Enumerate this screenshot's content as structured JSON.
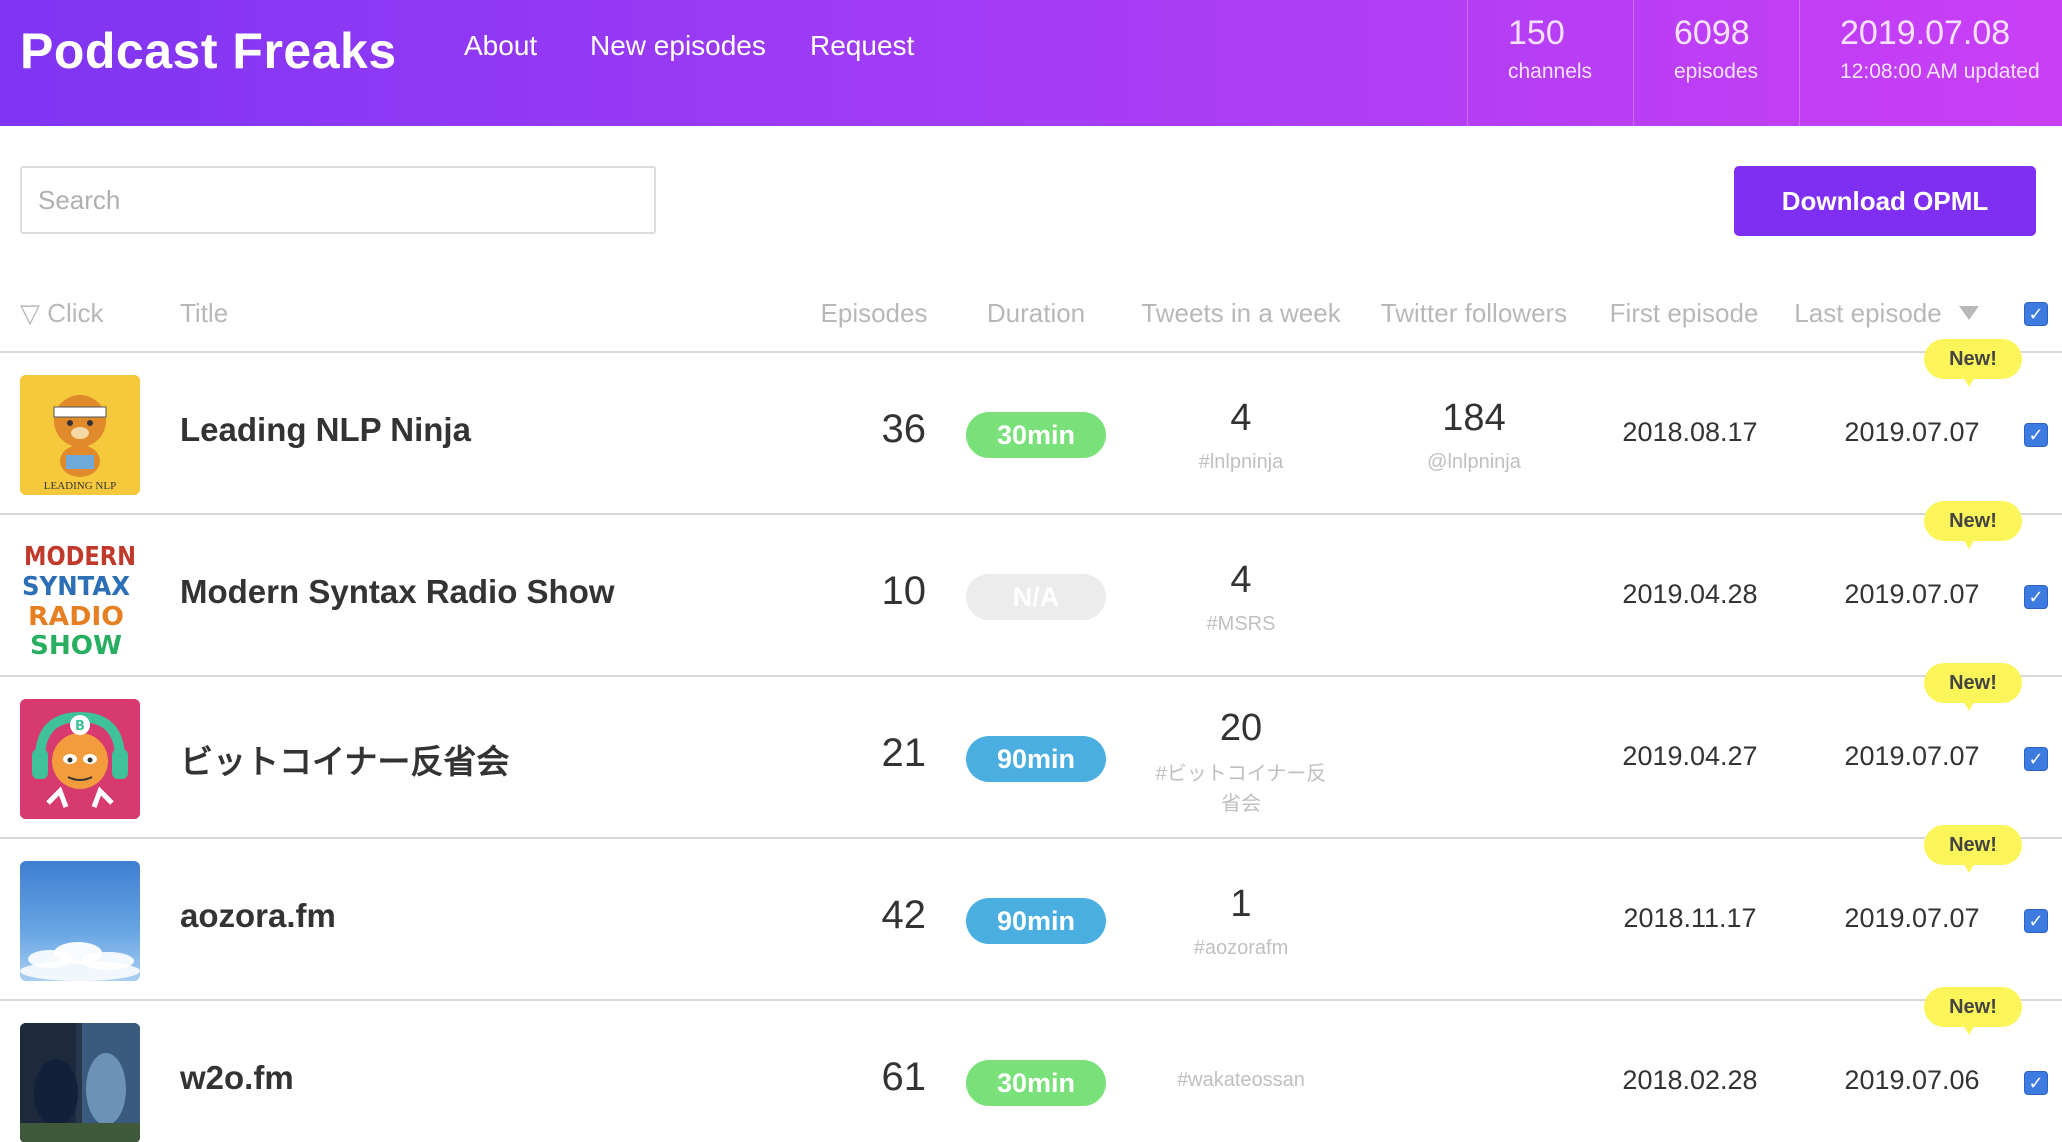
{
  "header": {
    "brand": "Podcast Freaks",
    "nav": [
      "About",
      "New episodes",
      "Request"
    ],
    "stats": [
      {
        "value": "150",
        "label": "channels"
      },
      {
        "value": "6098",
        "label": "episodes"
      },
      {
        "value": "2019.07.08",
        "label": "12:08:00 AM updated"
      }
    ]
  },
  "toolbar": {
    "search_placeholder": "Search",
    "download_label": "Download OPML"
  },
  "table": {
    "columns": [
      "▽ Click",
      "Title",
      "Episodes",
      "Duration",
      "Tweets in a week",
      "Twitter followers",
      "First episode",
      "Last episode"
    ],
    "new_label": "New!",
    "check_glyph": "✓",
    "rows": [
      {
        "title": "Leading NLP Ninja",
        "episodes": "36",
        "duration": "30min",
        "duration_color": "green",
        "tweets": "4",
        "hashtag": "#lnlpninja",
        "followers": "184",
        "twitter": "@lnlpninja",
        "first": "2018.08.17",
        "last": "2019.07.07",
        "thumb": "ninja-bear-icon"
      },
      {
        "title": "Modern Syntax Radio Show",
        "episodes": "10",
        "duration": "N/A",
        "duration_color": "na",
        "tweets": "4",
        "hashtag": "#MSRS",
        "followers": "",
        "twitter": "",
        "first": "2019.04.28",
        "last": "2019.07.07",
        "thumb": "msrs-logo",
        "logo_lines": [
          "MODERN",
          "SYNTAX",
          "RADIO",
          "SHOW"
        ]
      },
      {
        "title": "ビットコイナー反省会",
        "episodes": "21",
        "duration": "90min",
        "duration_color": "blue",
        "tweets": "20",
        "hashtag": "#ビットコイナー反省会",
        "followers": "",
        "twitter": "",
        "first": "2019.04.27",
        "last": "2019.07.07",
        "thumb": "bitcoiner-icon"
      },
      {
        "title": "aozora.fm",
        "episodes": "42",
        "duration": "90min",
        "duration_color": "blue",
        "tweets": "1",
        "hashtag": "#aozorafm",
        "followers": "",
        "twitter": "",
        "first": "2018.11.17",
        "last": "2019.07.07",
        "thumb": "sky-clouds-icon"
      },
      {
        "title": "w2o.fm",
        "episodes": "61",
        "duration": "30min",
        "duration_color": "green",
        "tweets": "",
        "hashtag": "#wakateossan",
        "followers": "",
        "twitter": "",
        "first": "2018.02.28",
        "last": "2019.07.06",
        "thumb": "people-photo-icon"
      }
    ]
  }
}
